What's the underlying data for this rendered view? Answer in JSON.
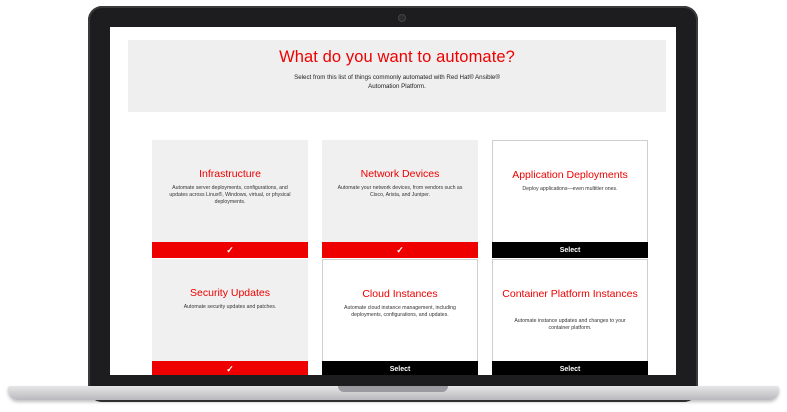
{
  "hero": {
    "title": "What do you want to automate?",
    "subtitle": "Select from this list of things commonly automated with Red Hat® Ansible® Automation Platform."
  },
  "cards": [
    {
      "title": "Infrastructure",
      "description": "Automate server deployments, configurations, and updates across Linux®, Windows, virtual, or physical deployments.",
      "state": "selected",
      "button_label": "✓"
    },
    {
      "title": "Network Devices",
      "description": "Automate your network devices, from vendors such as Cisco, Arista, and Juniper.",
      "state": "selected",
      "button_label": "✓"
    },
    {
      "title": "Application Deployments",
      "description": "Deploy applications—even multitier ones.",
      "state": "unselected",
      "button_label": "Select"
    },
    {
      "title": "Security Updates",
      "description": "Automate security updates and patches.",
      "state": "selected",
      "button_label": "✓"
    },
    {
      "title": "Cloud Instances",
      "description": "Automate cloud instance management, including deployments, configurations, and updates.",
      "state": "unselected",
      "button_label": "Select"
    },
    {
      "title": "Container Platform Instances",
      "description": "Automate instance updates and changes to your container platform.",
      "state": "unselected",
      "button_label": "Select"
    }
  ],
  "colors": {
    "accent": "#ee0000",
    "selected_bar": "#ee0000",
    "unselected_bar": "#000000",
    "card_background": "#f0f0f0",
    "hero_background": "#efefef"
  }
}
